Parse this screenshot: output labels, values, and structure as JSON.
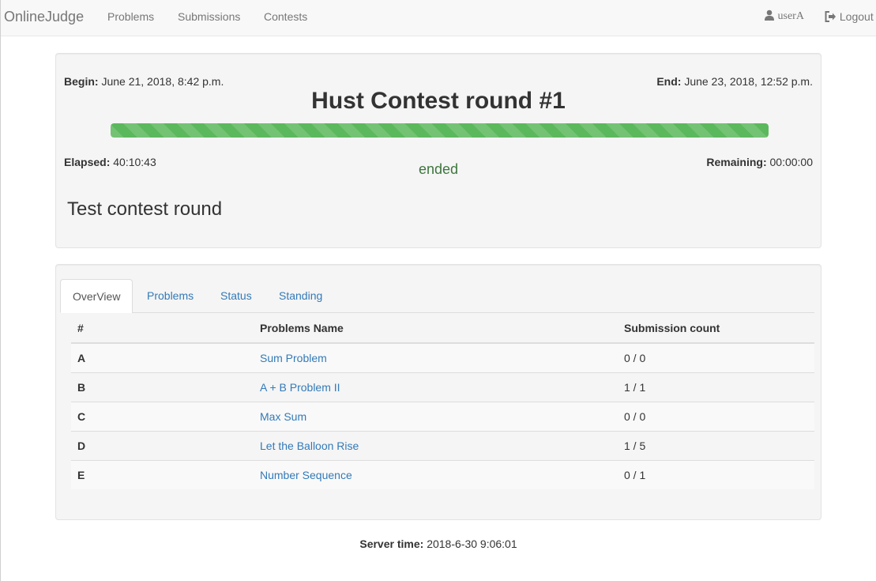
{
  "navbar": {
    "brand": "OnlineJudge",
    "links": [
      "Problems",
      "Submissions",
      "Contests"
    ],
    "user": "userA",
    "logout": "Logout",
    "user_icon": "user-icon",
    "logout_icon": "logout-icon"
  },
  "contest": {
    "begin_label": "Begin:",
    "begin": "June 21, 2018, 8:42 p.m.",
    "end_label": "End:",
    "end": "June 23, 2018, 12:52 p.m.",
    "title": "Hust Contest round #1",
    "progress_percent": 100,
    "elapsed_label": "Elapsed:",
    "elapsed": "40:10:43",
    "remaining_label": "Remaining:",
    "remaining": "00:00:00",
    "status": "ended",
    "description": "Test contest round"
  },
  "tabs": [
    "OverView",
    "Problems",
    "Status",
    "Standing"
  ],
  "table": {
    "headers": [
      "#",
      "Problems Name",
      "Submission count"
    ],
    "rows": [
      {
        "id": "A",
        "name": "Sum Problem",
        "count": "0 / 0"
      },
      {
        "id": "B",
        "name": "A + B Problem II",
        "count": "1 / 1"
      },
      {
        "id": "C",
        "name": "Max Sum",
        "count": "0 / 0"
      },
      {
        "id": "D",
        "name": "Let the Balloon Rise",
        "count": "1 / 5"
      },
      {
        "id": "E",
        "name": "Number Sequence",
        "count": "0 / 1"
      }
    ]
  },
  "footer": {
    "server_time_label": "Server time:",
    "server_time": "2018-6-30 9:06:01"
  },
  "colors": {
    "link": "#337ab7",
    "progress": "#5cb85c",
    "status_ended": "#3c763d",
    "panel_bg": "#f5f5f5"
  }
}
